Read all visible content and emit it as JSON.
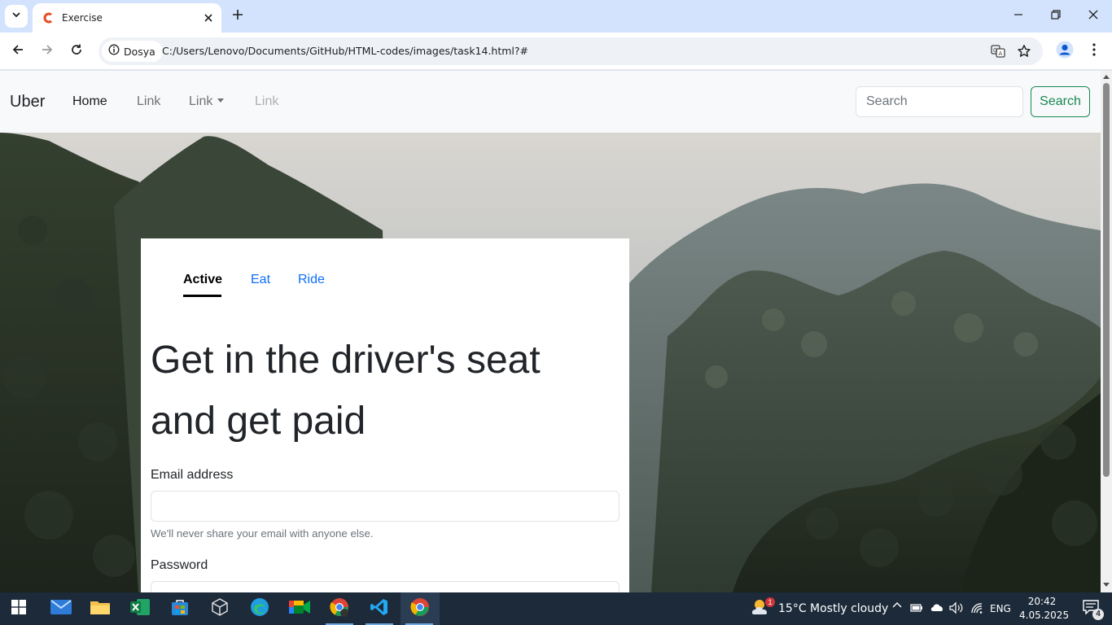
{
  "browser": {
    "tab_title": "Exercise",
    "site_chip_label": "Dosya",
    "url": "C:/Users/Lenovo/Documents/GitHub/HTML-codes/images/task14.html?#"
  },
  "navbar": {
    "brand": "Uber",
    "links": [
      "Home",
      "Link",
      "Link",
      "Link"
    ],
    "search_placeholder": "Search",
    "search_button": "Search"
  },
  "card": {
    "tabs": [
      "Active",
      "Eat",
      "Ride"
    ],
    "headline": "Get in the driver's seat and get paid",
    "email_label": "Email address",
    "email_help": "We'll never share your email with anyone else.",
    "password_label": "Password"
  },
  "taskbar": {
    "weather_badge": "1",
    "weather_text": "15°C  Mostly cloudy",
    "language": "ENG",
    "time": "20:42",
    "date": "4.05.2025",
    "notification_count": "4"
  },
  "colors": {
    "tabbar": "#d3e3fd",
    "navbar_bg": "#f8f9fa",
    "search_button": "#198754",
    "tab_link": "#0d6efd",
    "taskbar": "#1c2a3a"
  }
}
